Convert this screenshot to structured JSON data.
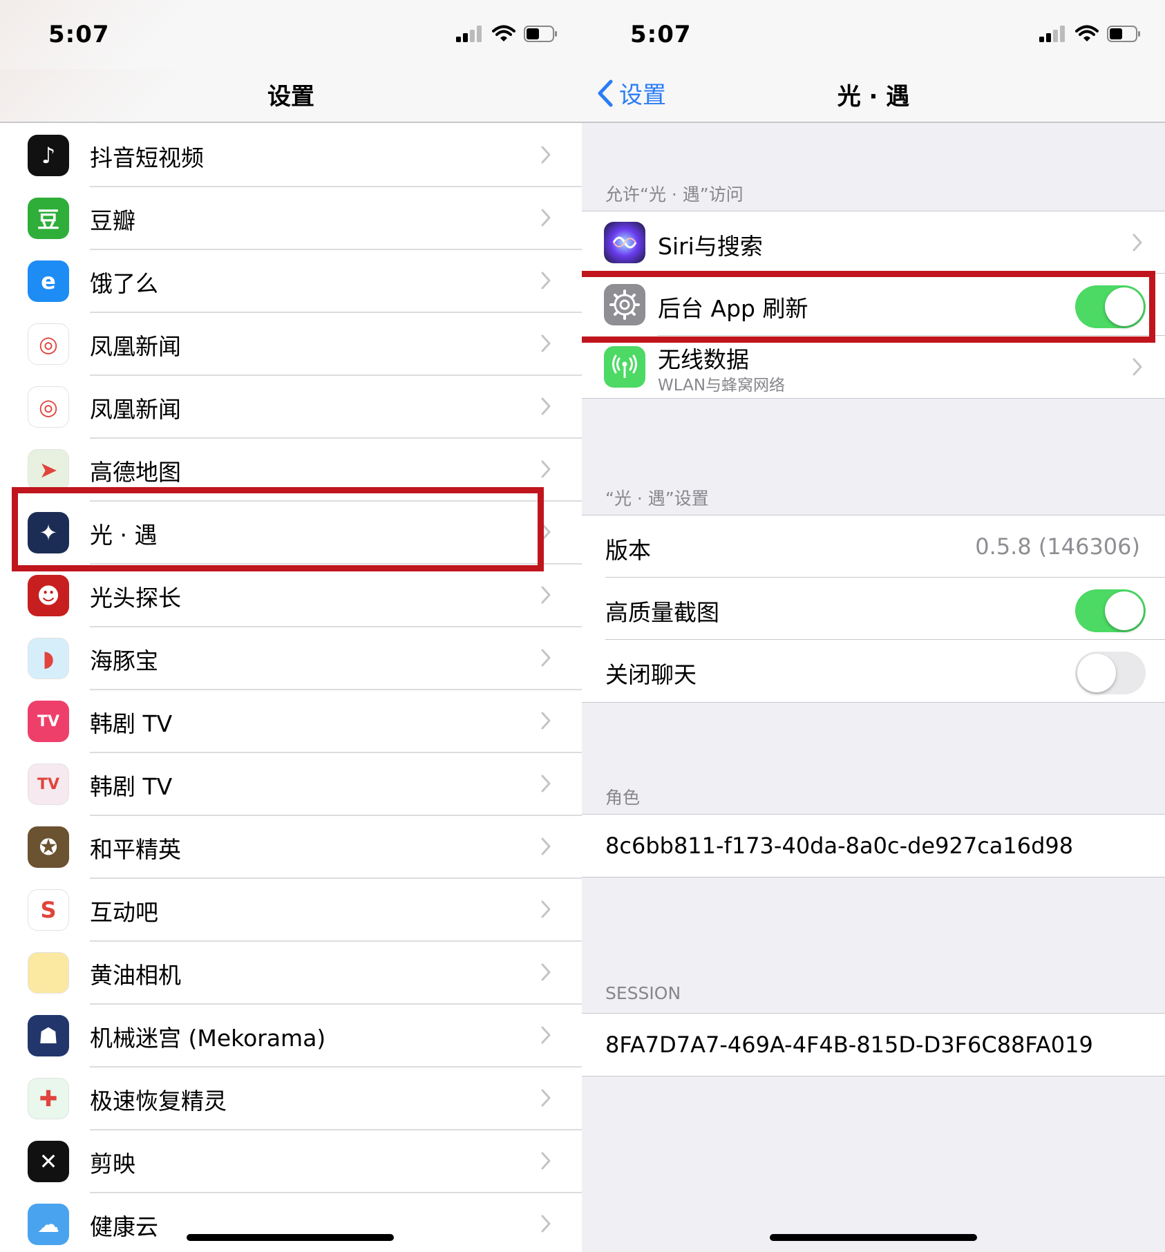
{
  "left": {
    "status": {
      "time": "5:07"
    },
    "nav_title": "设置",
    "apps": [
      {
        "label": "抖音短视频",
        "icon": "douyin-icon",
        "icon_bg": "#111111",
        "glyph": "♪"
      },
      {
        "label": "豆瓣",
        "icon": "douban-icon",
        "icon_bg": "#2fae39",
        "glyph": "豆"
      },
      {
        "label": "饿了么",
        "icon": "eleme-icon",
        "icon_bg": "#1e8cf5",
        "glyph": "e"
      },
      {
        "label": "凤凰新闻",
        "icon": "ifeng-news-icon",
        "icon_bg": "#ffffff",
        "glyph": "◎"
      },
      {
        "label": "凤凰新闻",
        "icon": "ifeng-news-icon",
        "icon_bg": "#ffffff",
        "glyph": "◎"
      },
      {
        "label": "高德地图",
        "icon": "amap-icon",
        "icon_bg": "#e8f1e0",
        "glyph": "➤"
      },
      {
        "label": "光 · 遇",
        "icon": "sky-game-icon",
        "icon_bg": "#1c2d55",
        "glyph": "✦"
      },
      {
        "label": "光头探长",
        "icon": "bald-detective-icon",
        "icon_bg": "#c71f1f",
        "glyph": "☻"
      },
      {
        "label": "海豚宝",
        "icon": "dolphin-icon",
        "icon_bg": "#d6eefa",
        "glyph": "◗"
      },
      {
        "label": "韩剧 TV",
        "icon": "korean-drama-tv-icon",
        "icon_bg": "#ee3f6b",
        "glyph": "TV"
      },
      {
        "label": "韩剧 TV",
        "icon": "korean-drama-tv-icon",
        "icon_bg": "#f6e9ef",
        "glyph": "TV"
      },
      {
        "label": "和平精英",
        "icon": "peace-elite-icon",
        "icon_bg": "#6b5230",
        "glyph": "✪"
      },
      {
        "label": "互动吧",
        "icon": "hudongba-icon",
        "icon_bg": "#ffffff",
        "glyph": "S"
      },
      {
        "label": "黄油相机",
        "icon": "butter-camera-icon",
        "icon_bg": "#fbe9a2",
        "glyph": ""
      },
      {
        "label": "机械迷宫 (Mekorama)",
        "icon": "mekorama-icon",
        "icon_bg": "#23366b",
        "glyph": "☗"
      },
      {
        "label": "极速恢复精灵",
        "icon": "recovery-icon",
        "icon_bg": "#e9f7ec",
        "glyph": "✚"
      },
      {
        "label": "剪映",
        "icon": "capcut-icon",
        "icon_bg": "#111111",
        "glyph": "✕"
      },
      {
        "label": "健康云",
        "icon": "health-cloud-icon",
        "icon_bg": "#4aa3ee",
        "glyph": "☁"
      }
    ]
  },
  "right": {
    "status": {
      "time": "5:07"
    },
    "back_label": "设置",
    "nav_title": "光 · 遇",
    "access_header": "允许“光 · 遇”访问",
    "siri_label": "Siri与搜索",
    "bg_refresh_label": "后台 App 刷新",
    "bg_refresh_on": true,
    "wireless_label": "无线数据",
    "wireless_sub": "WLAN与蜂窝网络",
    "settings_header": "“光 · 遇”设置",
    "version_label": "版本",
    "version_value": "0.5.8 (146306)",
    "hq_label": "高质量截图",
    "hq_on": true,
    "chat_label": "关闭聊天",
    "chat_on": false,
    "role_header": "角色",
    "role_value": "8c6bb811-f173-40da-8a0c-de927ca16d98",
    "session_header": "SESSION",
    "session_value": "8FA7D7A7-469A-4F4B-815D-D3F6C88FA019"
  },
  "colors": {
    "accent": "#2a7cf6",
    "toggle_on": "#4cd964",
    "highlight": "#c0151d"
  }
}
